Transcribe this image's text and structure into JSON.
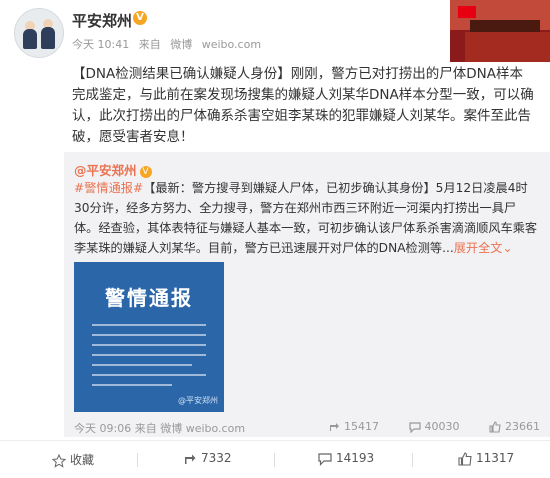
{
  "header": {
    "username": "平安郑州",
    "verified": "V",
    "time": "今天 10:41",
    "source_prefix": "来自",
    "source": "微博",
    "domain": "weibo.com"
  },
  "post": {
    "text": "【DNA检测结果已确认嫌疑人身份】刚刚，警方已对打捞出的尸体DNA样本完成鉴定，与此前在案发现场搜集的嫌疑人刘某华DNA样本分型一致，可以确认，此次打捞出的尸体确系杀害空姐李某珠的犯罪嫌疑人刘某华。案件至此告破，愿受害者安息！"
  },
  "repost": {
    "username": "@平安郑州",
    "verified": "V",
    "tag": "#警情通报#",
    "text": "【最新：警方搜寻到嫌疑人尸体，已初步确认其身份】5月12日凌晨4时30分许，经多方努力、全力搜寻，警方在郑州市西三环附近一河渠内打捞出一具尸体。经查验，其体表特征与嫌疑人基本一致，可初步确认该尸体系杀害滴滴顺风车乘客李某珠的嫌疑人刘某华。目前，警方已迅速展开对尸体的DNA检测等...",
    "expand": "展开全文",
    "poster_title": "警情通报",
    "poster_watermark": "@平安郑州",
    "time": "今天 09:06",
    "source_prefix": "来自",
    "source": "微博",
    "domain": "weibo.com",
    "reposts": "15417",
    "comments": "40030",
    "likes": "23661"
  },
  "footer": {
    "favorite": "收藏",
    "reposts": "7332",
    "comments": "14193",
    "likes": "11317"
  },
  "colors": {
    "accent": "#eb7350",
    "verified": "#f6a623",
    "poster": "#2b67a8"
  }
}
